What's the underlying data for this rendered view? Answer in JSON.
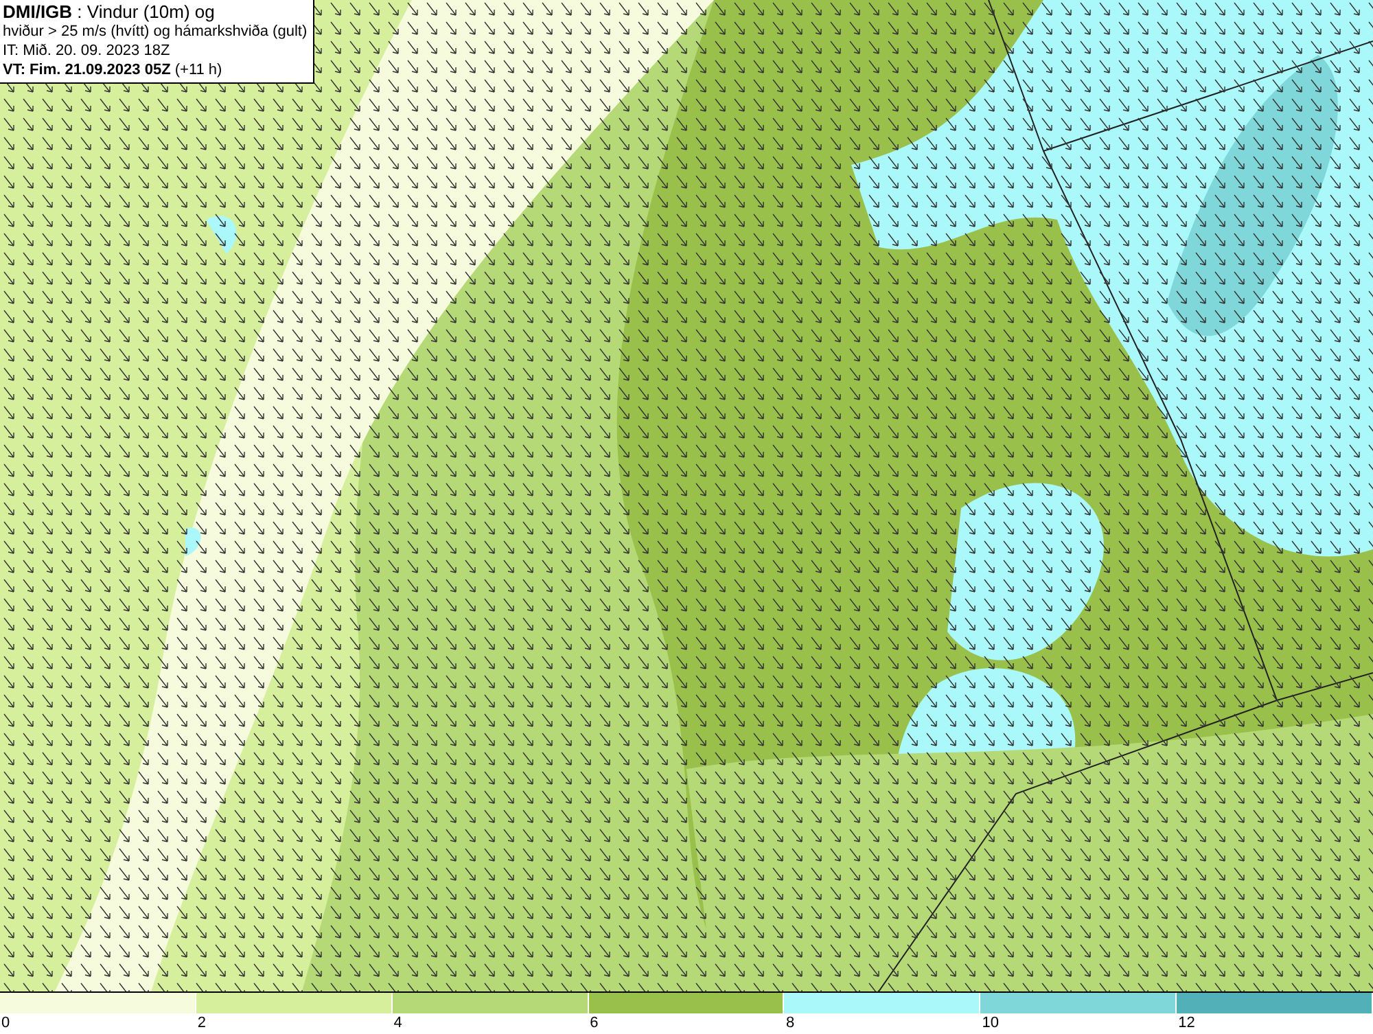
{
  "header": {
    "lines": [
      "**DMI/IGB** : Vindur (10m) og",
      "hviður > 25 m/s (hvítt) og hámarkshviða (gult)",
      "IT: Mið. 20. 09. 2023 18Z",
      "**VT: Fim. 21.09.2023 05Z** (+11 h)"
    ]
  },
  "legend": {
    "bins": [
      {
        "label": "0",
        "color": "#f6fbde"
      },
      {
        "label": "2",
        "color": "#d6ef9c"
      },
      {
        "label": "4",
        "color": "#b6d978"
      },
      {
        "label": "6",
        "color": "#99c04a"
      },
      {
        "label": "8",
        "color": "#aaf8fa"
      },
      {
        "label": "10",
        "color": "#80d7d9"
      },
      {
        "label": "12",
        "color": "#52b1b8"
      }
    ]
  }
}
